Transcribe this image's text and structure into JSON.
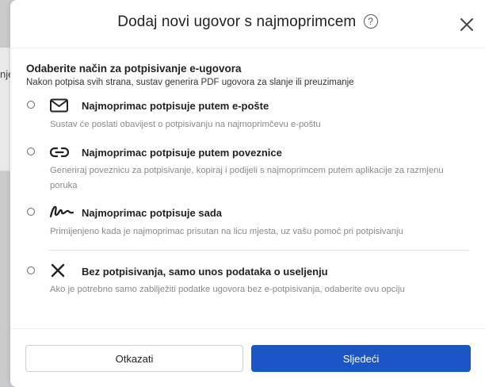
{
  "backdrop": {
    "partial_text": "nje"
  },
  "modal": {
    "title": "Dodaj novi ugovor s najmoprimcem",
    "help_glyph": "?"
  },
  "section": {
    "title": "Odaberite način za potpisivanje e-ugovora",
    "subtitle": "Nakon potpisa svih strana, sustav generira PDF ugovora za slanje ili preuzimanje"
  },
  "options": [
    {
      "icon": "envelope-icon",
      "label": "Najmoprimac potpisuje putem e-pošte",
      "description": "Sustav će poslati obavijest o potpisivanju na najmoprimčevu e-poštu"
    },
    {
      "icon": "link-icon",
      "label": "Najmoprimac potpisuje putem poveznice",
      "description": "Generiraj poveznicu za potpisivanje, kopiraj i podijeli s najmoprimcem putem aplikacije za razmjenu poruka"
    },
    {
      "icon": "signature-icon",
      "label": "Najmoprimac potpisuje sada",
      "description": "Primijenjeno kada je najmoprimac prisutan na licu mjesta, uz vašu pomoć pri potpisivanju"
    },
    {
      "icon": "x-icon",
      "label": "Bez potpisivanja, samo unos podataka o useljenju",
      "description": "Ako je potrebno samo zabilježiti podatke ugovora bez e-potpisivanja, odaberite ovu opciju"
    }
  ],
  "footer": {
    "cancel_label": "Otkazati",
    "next_label": "Sljedeći"
  },
  "colors": {
    "primary": "#1a56c6",
    "muted_text": "#8a8a8a"
  }
}
